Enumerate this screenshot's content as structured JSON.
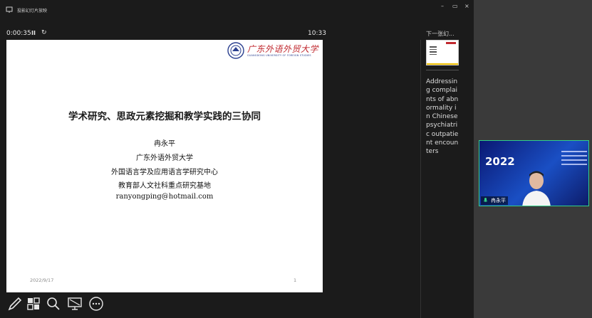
{
  "window": {
    "title": "投影幻灯片放映",
    "minimize": "–",
    "restore": "▭",
    "close": "×"
  },
  "presenter": {
    "elapsed": "0:00:35",
    "pause_symbol": "II",
    "restart_symbol": "↻",
    "clock": "10:33"
  },
  "slide": {
    "logo_cn": "广东外语外贸大学",
    "logo_en": "GUANGDONG UNIVERSITY OF FOREIGN STUDIES",
    "title": "学术研究、思政元素挖掘和教学实践的三协同",
    "lines": [
      "冉永平",
      "广东外语外贸大学",
      "外国语言学及应用语言学研究中心",
      "教育部人文社科重点研究基地",
      "ranyongping@hotmail.com"
    ],
    "date": "2022/9/17",
    "page_number": "1"
  },
  "next": {
    "label": "下一张幻..."
  },
  "notes": "Addressing complaints of abnormality in Chinese psychiatric outpatient encounters",
  "video": {
    "year": "2022",
    "name": "冉永平"
  },
  "colors": {
    "accent_green": "#32d08a",
    "logo_red": "#c0292f"
  }
}
